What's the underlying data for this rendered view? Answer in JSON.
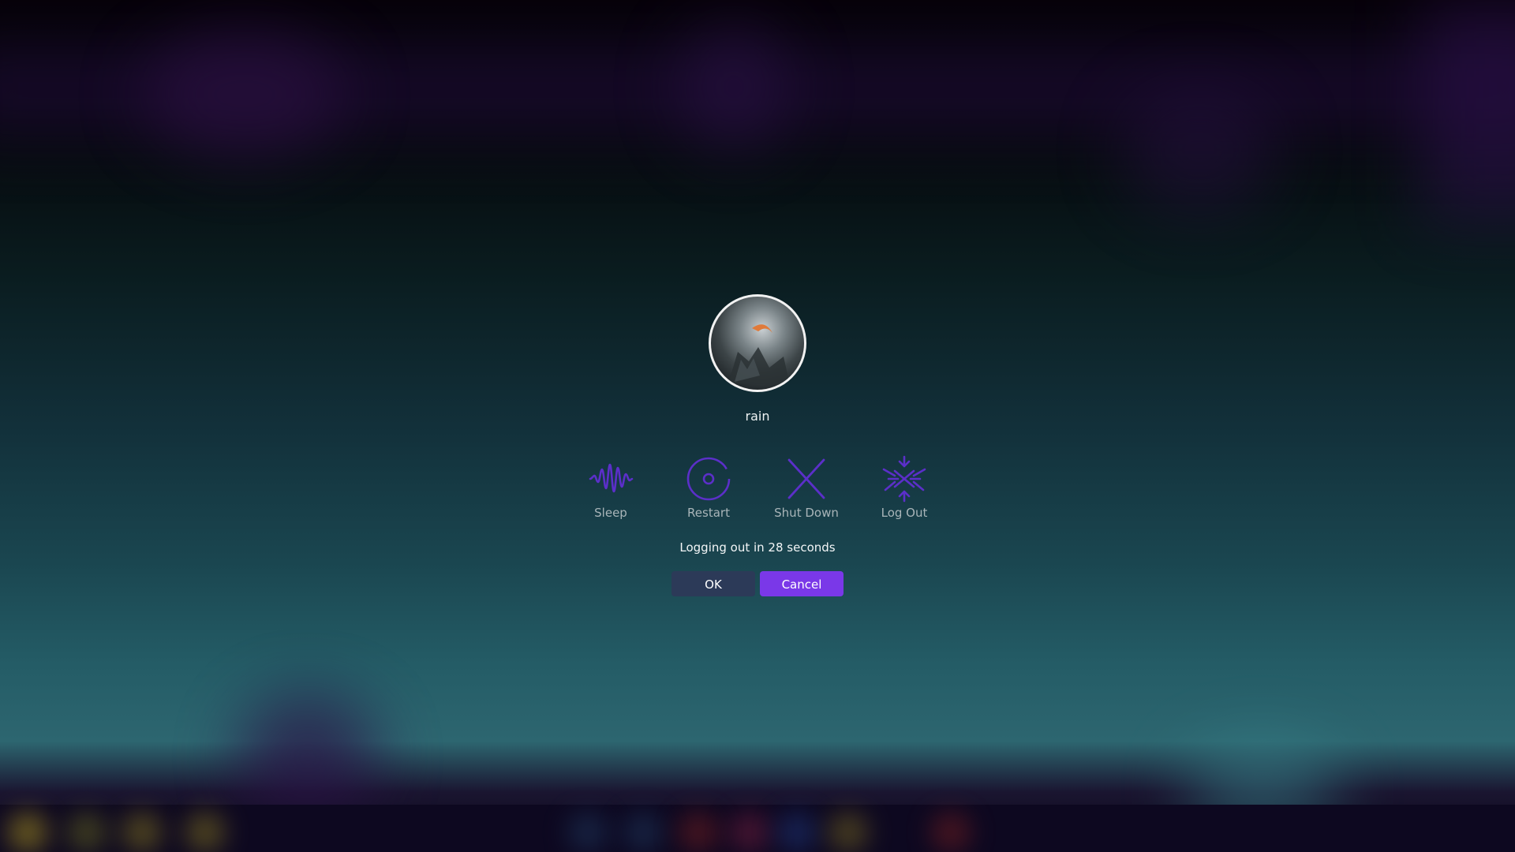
{
  "dialog": {
    "username": "rain",
    "actions": [
      {
        "label": "Sleep",
        "icon": "sleep-icon"
      },
      {
        "label": "Restart",
        "icon": "restart-icon"
      },
      {
        "label": "Shut Down",
        "icon": "shutdown-icon"
      },
      {
        "label": "Log Out",
        "icon": "logout-icon"
      }
    ],
    "status": "Logging out in 28 seconds",
    "buttons": {
      "ok": "OK",
      "cancel": "Cancel"
    }
  },
  "colors": {
    "icon_accent": "#5b2fc9",
    "cancel_button": "#7a38e8",
    "ok_button": "#2c3a58"
  }
}
